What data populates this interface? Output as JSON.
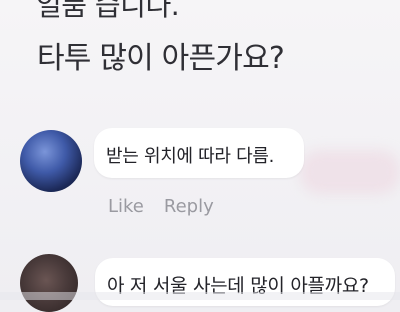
{
  "question": {
    "partial_line": "일품 습니다.",
    "main_line": "타투 많이 아픈가요?"
  },
  "comments": [
    {
      "text": "받는 위치에 따라 다름.",
      "actions": {
        "like_label": "Like",
        "reply_label": "Reply"
      }
    },
    {
      "text": "아 저 서울 사는데 많이 아플까요?"
    }
  ],
  "colors": {
    "background": "#efeef2",
    "bubble": "#ffffff",
    "text": "#232329",
    "muted_text": "#9a9aa1"
  },
  "icons": {
    "avatar_1": "avatar",
    "avatar_2": "avatar"
  }
}
